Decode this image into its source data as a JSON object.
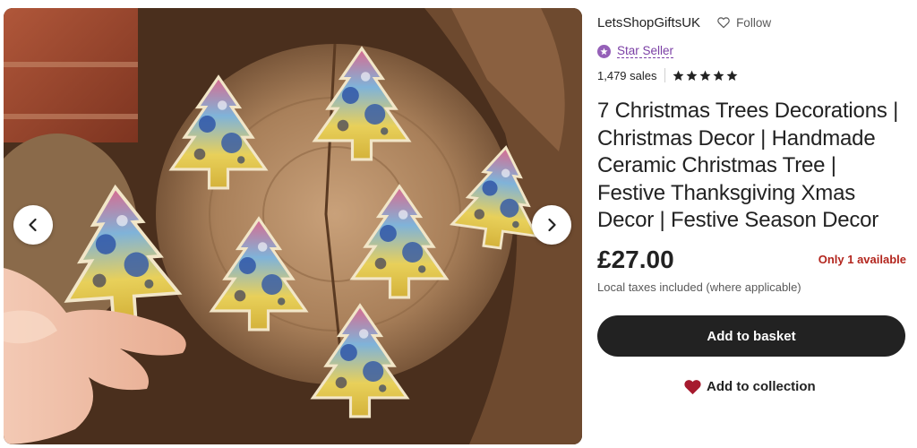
{
  "shop": {
    "name": "LetsShopGiftsUK",
    "follow_label": "Follow",
    "star_seller_label": "Star Seller",
    "sales": "1,479 sales",
    "rating": 5
  },
  "listing": {
    "title": "7 Christmas Trees Decorations | Christmas Decor | Handmade Ceramic Christmas Tree | Festive Thanksgiving Xmas Decor | Festive Season Decor",
    "price": "£27.00",
    "availability": "Only 1 available",
    "tax_note": "Local taxes included (where applicable)"
  },
  "actions": {
    "add_to_basket": "Add to basket",
    "add_to_collection": "Add to collection"
  },
  "gallery": {
    "prev_icon": "chevron-left-icon",
    "next_icon": "chevron-right-icon"
  },
  "colors": {
    "star_seller_purple": "#7b3fa5",
    "availability_red": "#b3261e",
    "button_dark": "#222222",
    "heart_red": "#a61a2e"
  }
}
